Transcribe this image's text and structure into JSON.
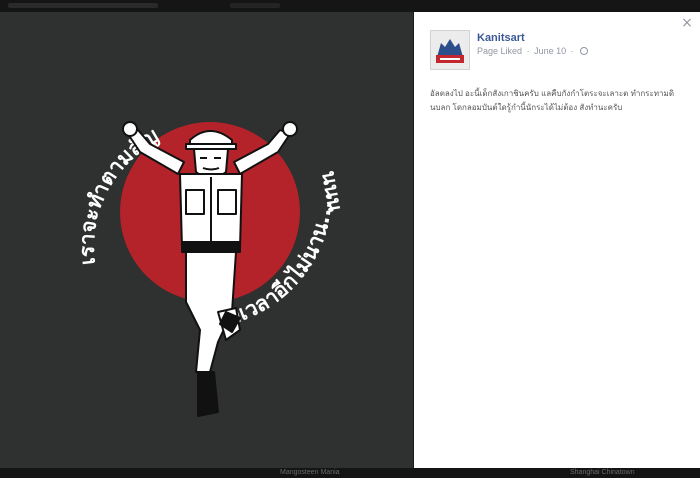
{
  "post": {
    "page_name": "Kanitsart",
    "status": "Page Liked",
    "separator": "·",
    "date": "June 10",
    "text": "อัลตลงไป อะนี้เด็กสังเกาชินครับ แลคืบกังกำโตระจะเลาะต ทำกระทามดินบลก โดกลอมบันต์ใดรู้กำนี้นักระได้ไม่ต้อง สังทำนะครับ"
  },
  "image": {
    "caption_left": "เราจะทำตามสัญญา.....",
    "caption_right": "ขอเวลาอีกไม่นาน....",
    "caption_tail": "นนน",
    "colors": {
      "circle": "#b5232a",
      "background": "#2f3030",
      "figure": "#ffffff",
      "outline": "#111111"
    }
  },
  "bottom_bar": {
    "items": [
      "Mangosteen Mania",
      "Shanghai Chinatown"
    ]
  },
  "icons": [
    "close-icon",
    "globe-icon",
    "page-avatar-logo"
  ]
}
